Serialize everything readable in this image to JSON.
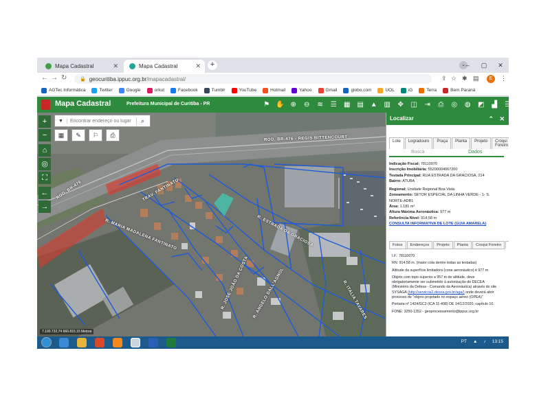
{
  "browser": {
    "tabs": [
      {
        "title": "Mapa Cadastral",
        "active": false
      },
      {
        "title": "Mapa Cadastral",
        "active": true
      }
    ],
    "new_tab": "+",
    "url_host": "geocuritiba.ippuc.org.br",
    "url_path": "/mapacadastral/",
    "profile_initial": "E",
    "bookmarks": [
      {
        "label": "AGTec Informática",
        "color": "#1565c0"
      },
      {
        "label": "Twitter",
        "color": "#1da1f2"
      },
      {
        "label": "Google",
        "color": "#4285f4"
      },
      {
        "label": "orkut",
        "color": "#d81b60"
      },
      {
        "label": "Facebook",
        "color": "#1877f2"
      },
      {
        "label": "Tumblr",
        "color": "#35465c"
      },
      {
        "label": "YouTube",
        "color": "#ff0000"
      },
      {
        "label": "Hotmail",
        "color": "#f25022"
      },
      {
        "label": "Yahoo",
        "color": "#5f01d1"
      },
      {
        "label": "Gmail",
        "color": "#ea4335"
      },
      {
        "label": "globo.com",
        "color": "#1565c0"
      },
      {
        "label": "UOL",
        "color": "#f9a825"
      },
      {
        "label": "iG",
        "color": "#00897b"
      },
      {
        "label": "Terra",
        "color": "#ef6c00"
      },
      {
        "label": "Bem Paraná",
        "color": "#c62828"
      }
    ]
  },
  "app": {
    "title": "Mapa Cadastral",
    "subtitle": "Prefeitura Municipal de Curitiba - PR",
    "accent": "#2e8b3e"
  },
  "map": {
    "search_placeholder": "Encontrar endereço ou lugar",
    "coords": "7.190.732,74 660.815,15 Metros",
    "road_labels": {
      "br": "ROD. BR-476 - REGIS BITTENCOURT",
      "br_short": "ROD. BR-476",
      "graciosa": "R. ESTRADA DA GRACIOSA",
      "antonio": "R. MARIA MADALENA FANTINATO",
      "traf": "TRAV. FANTINATO",
      "r1": "R. JOSE JOÃO DA COSTA",
      "r2": "R. ANGELO DALL'AGNOL",
      "r3": "R. ITALIA TAVARES"
    }
  },
  "panel": {
    "title": "Localizar",
    "tabs": [
      "Lote",
      "Logradouro",
      "Praça",
      "Planta",
      "Projeto",
      "Croqui Foreiro"
    ],
    "subtabs": [
      "Busca",
      "Dados"
    ],
    "info": {
      "indicacao": {
        "k": "Indicação Fiscal:",
        "v": "78110070"
      },
      "inscricao": {
        "k": "Inscrição Imobiliária:",
        "v": "55200004067200"
      },
      "testada": {
        "k": "Testada Principal:",
        "v": "RUA ESTRADA DA GRACIOSA, 214"
      },
      "bairro": {
        "k": "Bairro:",
        "v": "ATUBA"
      },
      "regional": {
        "k": "Regional:",
        "v": "Unidade Regional Boa Vista"
      },
      "zoneamento": {
        "k": "Zoneamento:",
        "v": "SETOR ESPECIAL DA LINHA VERDE - 1- S. NORTE-ADB1"
      },
      "area": {
        "k": "Área:",
        "v": "1.181 m²"
      },
      "altura": {
        "k": "Altura Máxima Aeronáutica:",
        "v": "977 m"
      },
      "referencia": {
        "k": "Referência Nível:",
        "v": "914,58 m"
      },
      "link": "CONSULTA INFORMATIVA DE LOTE (GUIA AMARELA)"
    },
    "detail_tabs": [
      "Fotos",
      "Endereços",
      "Projeto",
      "Planta",
      "Croqui Foreiro",
      "RN"
    ],
    "rn": {
      "if": "I.F.: 78110070",
      "rn": "RN: 914,58 m. (maior cota dentre todas as testadas)",
      "altitude": "Altitude da superfície limitadora (cone aeronáutico) é 977 m",
      "objeto": "Objeto com topo superior a 957 m de altitude, deve obrigatoriamente ser submetido à autorização do DECEA (Ministério da Defesa - Comando da Aeronáutica) através do site SYSAGA",
      "objeto_link": "(http://servicos2.decea.gov.br/aga/)",
      "objeto_end": "onde deverá abrir processo de \"objeto projetado no espaço aéreo (OPEA)\"",
      "portaria": "Portaria nº 1424/GC3 (ICA 11-408) DE 14/12/2020, capítulo 10.",
      "fone": "FONE: 3250-1352 - geoprocessamento@ippuc.org.br"
    }
  },
  "taskbar": {
    "lang": "PT",
    "time": "13:15"
  }
}
